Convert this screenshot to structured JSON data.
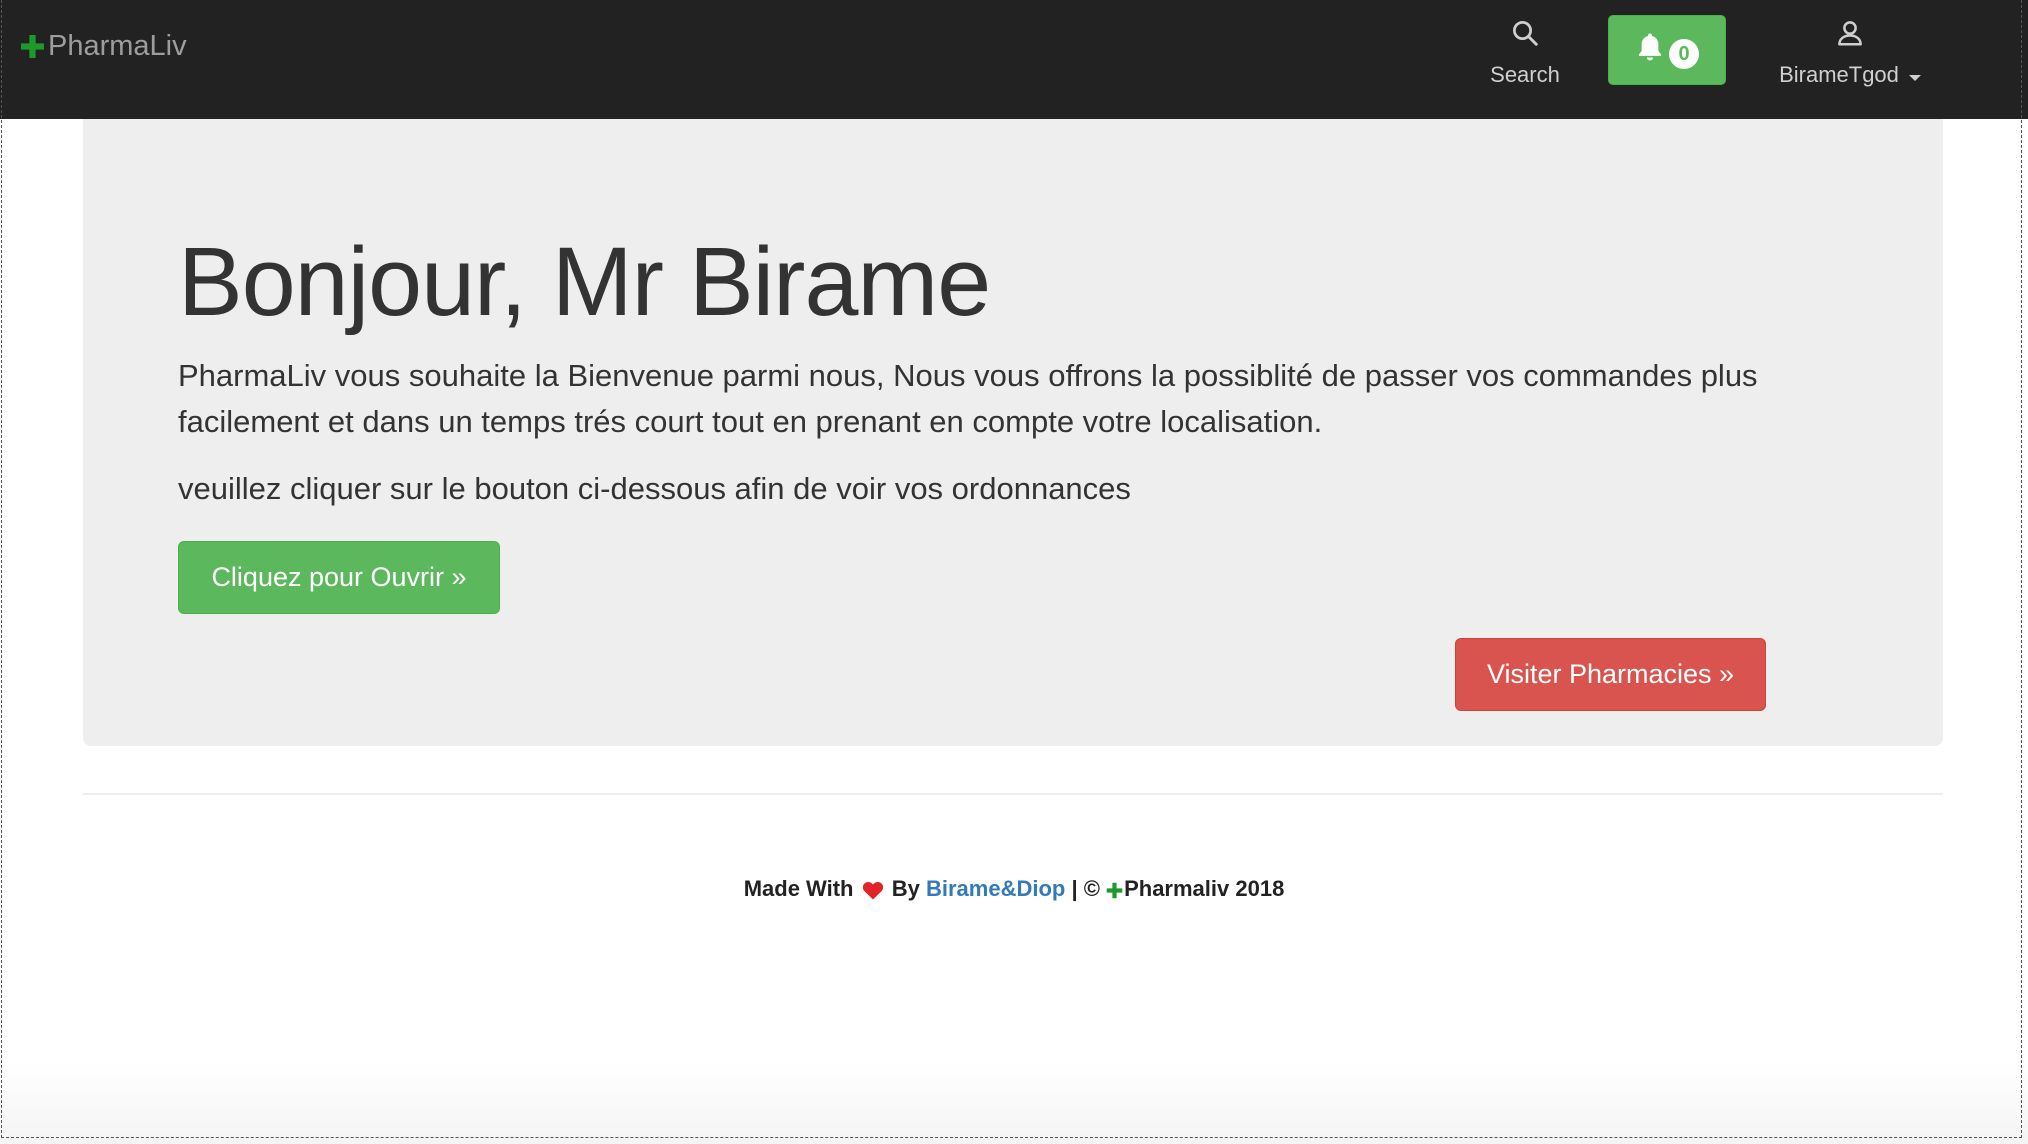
{
  "navbar": {
    "brand": "PharmaLiv",
    "search_label": "Search",
    "notifications_count": "0",
    "user_name": "BirameTgod"
  },
  "jumbotron": {
    "greeting": "Bonjour, Mr Birame",
    "lead": "PharmaLiv vous souhaite la Bienvenue parmi nous, Nous vous offrons la possiblité de passer vos commandes plus facilement et dans un temps trés court tout en prenant en compte votre localisation.",
    "instruction": "veuillez cliquer sur le bouton ci-dessous afin de voir vos ordonnances",
    "open_button": "Cliquez pour Ouvrir »",
    "visit_button": "Visiter Pharmacies »"
  },
  "footer": {
    "made_with": "Made With",
    "by": "By",
    "authors_link": "Birame&Diop",
    "separator": "| ©",
    "brand": "Pharmaliv 2018"
  },
  "colors": {
    "navbar_bg": "#222222",
    "success": "#5cb85c",
    "danger": "#d9534f",
    "link": "#337ab7",
    "heart": "#e0242a",
    "brand_cross": "#1e9a2c"
  },
  "icons": {
    "brand": "green-cross-icon",
    "search": "search-icon",
    "notifications": "bell-icon",
    "user": "user-icon",
    "user_menu": "caret-down-icon",
    "footer_heart": "heart-icon",
    "footer_brand": "green-cross-icon"
  }
}
